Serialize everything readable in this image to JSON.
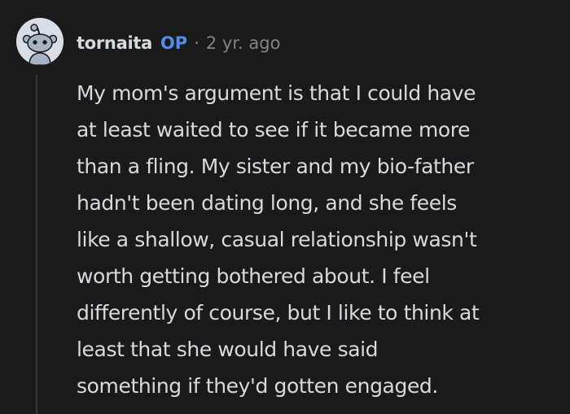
{
  "comment": {
    "author": "tornaita",
    "op_badge": "OP",
    "separator": "·",
    "timestamp": "2 yr. ago",
    "avatar_icon": "reddit-snoo-avatar-icon",
    "body_lines": [
      "My mom's argument is that I could have",
      "at least waited to see if it became more",
      "than a fling. My sister and my bio-father",
      "hadn't been dating long, and she feels",
      "like a shallow, casual relationship wasn't",
      "worth getting bothered about. I feel",
      "differently of course, but I like to think at",
      "least that she would have said",
      "something if they'd gotten engaged."
    ]
  },
  "colors": {
    "background": "#1a1a1b",
    "text": "#d7dadc",
    "op_accent": "#4f8fe8",
    "muted": "#818384",
    "thread_line": "#343536",
    "avatar_bg": "#d8dde6"
  }
}
